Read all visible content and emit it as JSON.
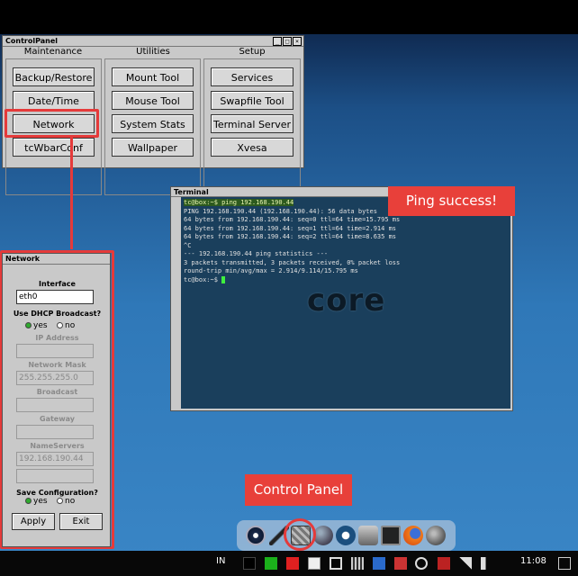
{
  "control_panel": {
    "title": "ControlPanel",
    "sections": [
      {
        "heading": "Maintenance",
        "buttons": [
          "Backup/Restore",
          "Date/Time",
          "Network",
          "tcWbarConf"
        ]
      },
      {
        "heading": "Utilities",
        "buttons": [
          "Mount Tool",
          "Mouse Tool",
          "System Stats",
          "Wallpaper"
        ]
      },
      {
        "heading": "Setup",
        "buttons": [
          "Services",
          "Swapfile Tool",
          "Terminal Server",
          "Xvesa"
        ]
      }
    ]
  },
  "terminal": {
    "title": "Terminal",
    "command_line": "tc@box:~$ ping 192.168.190.44",
    "output": [
      "PING 192.168.190.44 (192.168.190.44): 56 data bytes",
      "64 bytes from 192.168.190.44: seq=0 ttl=64 time=15.795 ms",
      "64 bytes from 192.168.190.44: seq=1 ttl=64 time=2.914 ms",
      "64 bytes from 192.168.190.44: seq=2 ttl=64 time=8.635 ms",
      "^C",
      "--- 192.168.190.44 ping statistics ---",
      "3 packets transmitted, 3 packets received, 0% packet loss",
      "round-trip min/avg/max = 2.914/9.114/15.795 ms"
    ],
    "prompt": "tc@box:~$ ",
    "logo_text": "core"
  },
  "network": {
    "title": "Network",
    "interface_label": "Interface",
    "interface_value": "eth0",
    "dhcp_label": "Use DHCP Broadcast?",
    "dhcp_yes": "yes",
    "dhcp_no": "no",
    "ip_label": "IP Address",
    "ip_value": "",
    "netmask_label": "Network Mask",
    "netmask_value": "255.255.255.0",
    "broadcast_label": "Broadcast",
    "broadcast_value": "",
    "gateway_label": "Gateway",
    "gateway_value": "",
    "nameservers_label": "NameServers",
    "ns1_value": "192.168.190.44",
    "ns2_value": "",
    "save_label": "Save Configuration?",
    "save_yes": "yes",
    "save_no": "no",
    "apply": "Apply",
    "exit": "Exit"
  },
  "callouts": {
    "ping": "Ping success!",
    "control_panel": "Control Panel"
  },
  "taskbar": {
    "lang": "IN",
    "time": "11:08"
  },
  "colors": {
    "annotation_red": "#e53a3a",
    "terminal_bg": "#1a3f5c",
    "desktop_blue": "#2f78b8"
  }
}
